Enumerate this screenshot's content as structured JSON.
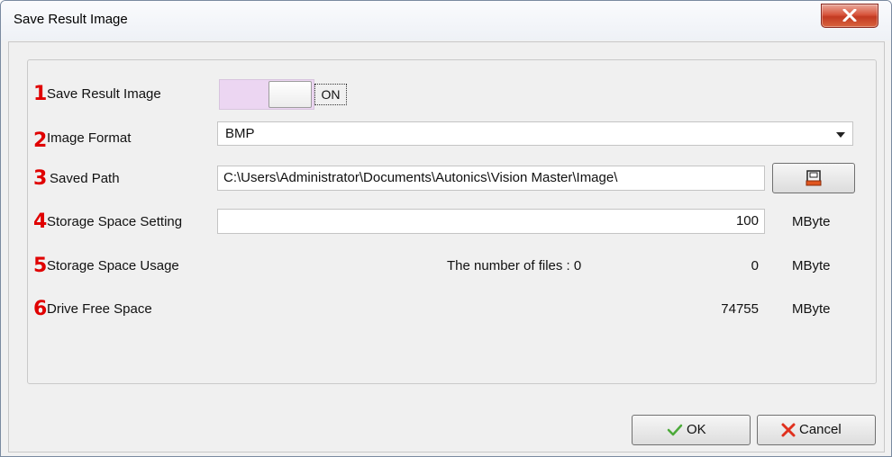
{
  "window": {
    "title": "Save Result Image"
  },
  "rows": {
    "save_result": {
      "number": "1",
      "label": "Save Result Image",
      "toggle_text": "ON"
    },
    "image_format": {
      "number": "2",
      "label": "Image Format",
      "value": "BMP"
    },
    "saved_path": {
      "number": "3",
      "label": "Saved Path",
      "value": "C:\\Users\\Administrator\\Documents\\Autonics\\Vision Master\\Image\\"
    },
    "storage_setting": {
      "number": "4",
      "label": "Storage Space Setting",
      "value": "100",
      "unit": "MByte"
    },
    "storage_usage": {
      "number": "5",
      "label": "Storage Space Usage",
      "files_text": "The number of files : 0",
      "value": "0",
      "unit": "MByte"
    },
    "drive_free": {
      "number": "6",
      "label": "Drive Free Space",
      "value": "74755",
      "unit": "MByte"
    }
  },
  "buttons": {
    "ok": "OK",
    "cancel": "Cancel"
  },
  "icons": {
    "close": "close-icon",
    "browse": "save-disk-icon",
    "ok": "check-icon",
    "cancel": "x-icon"
  },
  "colors": {
    "annotation": "#e00000",
    "toggle_track": "#ecd6f2"
  }
}
